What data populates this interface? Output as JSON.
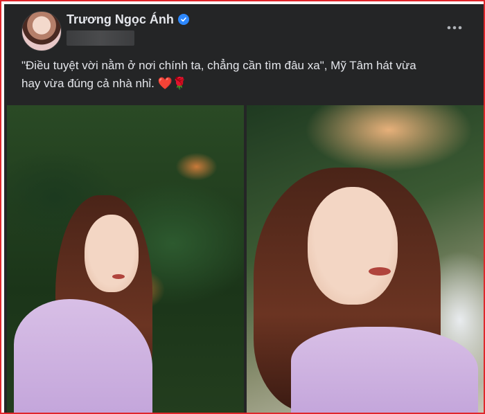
{
  "post": {
    "author_name": "Trương Ngọc Ánh",
    "text_line1": "\"Điều tuyệt vời nằm ở nơi chính ta, chẳng cần tìm đâu xa\", Mỹ Tâm hát vừa",
    "text_line2": "hay vừa đúng cả nhà nhỉ. ❤️🌹"
  },
  "icons": {
    "verified": "verified-badge-icon",
    "more": "more-options-icon"
  },
  "colors": {
    "background": "#242526",
    "text": "#e4e6eb",
    "verified": "#2d88ff",
    "frame_border": "#e0262b"
  }
}
